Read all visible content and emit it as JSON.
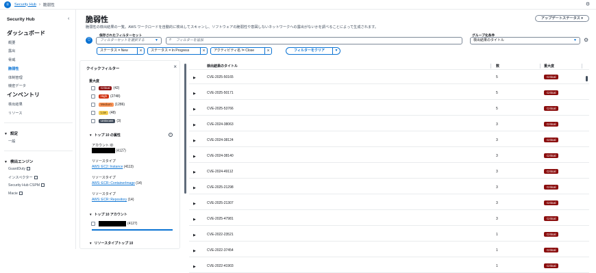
{
  "topbar": {
    "app_link": "Security Hub",
    "separator": "›",
    "current": "脆弱性"
  },
  "sidebar": {
    "title": "Security Hub",
    "sections": [
      {
        "heading": "ダッシュボード",
        "items": [
          "概要",
          "露出",
          "脅威",
          "脆弱性",
          "体制管理",
          "機密データ"
        ],
        "active": "脆弱性"
      },
      {
        "heading": "インベントリ",
        "items": [
          "検出結果",
          "リソース"
        ]
      }
    ],
    "settings": {
      "heading": "設定",
      "items": [
        "一般"
      ]
    },
    "engines": {
      "heading": "検出エンジン",
      "items": [
        "GuardDuty",
        "インスペクター",
        "Security Hub CSPM",
        "Macie"
      ]
    }
  },
  "page": {
    "title": "脆弱性",
    "description": "脆弱性の検出結果の一覧。AWS ワークロードを自動的に検出してスキャンし、ソフトウェアの脆弱性や意図しないネットワークへの露出がないかを調べることによって生成されます。",
    "update_status": "アップデートステータス",
    "saved_filter_label": "保存されたフィルターセット",
    "saved_filter_placeholder": "フィルターセットを選択する",
    "search_placeholder": "フィルターを追加",
    "group_label": "グループ化条件",
    "group_value": "検出結果のタイトル",
    "tokens": [
      "ステータス = New",
      "ステータス = In Progress",
      "アクティビティ名 != Close"
    ],
    "clear_label": "フィルターをクリア"
  },
  "quick_filter": {
    "title": "クイックフィルター",
    "severity_heading": "重大度",
    "severities": [
      {
        "label": "Critical",
        "count": "(42)",
        "color": "#8b0e0e"
      },
      {
        "label": "High",
        "count": "(2748)",
        "color": "#d13212"
      },
      {
        "label": "Medium",
        "count": "(1286)",
        "color": "#f89256"
      },
      {
        "label": "Low",
        "count": "(48)",
        "color": "#f2cd54"
      },
      {
        "label": "Unknown",
        "count": "(3)",
        "color": "#414d5c"
      }
    ],
    "top10_attr_heading": "トップ 10 の属性",
    "account_id_label": "アカウント ID",
    "account_id_count": "(4127)",
    "resource_types": [
      {
        "label": "リソースタイプ",
        "value": "AWS::EC2::Instance",
        "count": "(4113)"
      },
      {
        "label": "リソースタイプ",
        "value": "AWS::ECR::ContainerImage",
        "count": "(14)"
      },
      {
        "label": "リソースタイプ",
        "value": "AWS::ECR::Repository",
        "count": "(14)"
      }
    ],
    "top10_accounts_heading": "トップ 10 アカウント",
    "top10_account_count": "(4127)",
    "top10_resource_heading": "リソースタイプトップ 10"
  },
  "table": {
    "headers": {
      "title": "検出結果のタイトル",
      "count": "数",
      "severity": "重大度"
    },
    "rows": [
      {
        "title": "CVE-2025-50165",
        "count": "5",
        "severity": "Critical"
      },
      {
        "title": "CVE-2025-50171",
        "count": "5",
        "severity": "Critical"
      },
      {
        "title": "CVE-2025-53766",
        "count": "5",
        "severity": "Critical"
      },
      {
        "title": "CVE-2024-38063",
        "count": "3",
        "severity": "Critical"
      },
      {
        "title": "CVE-2024-38124",
        "count": "3",
        "severity": "Critical"
      },
      {
        "title": "CVE-2024-38140",
        "count": "3",
        "severity": "Critical"
      },
      {
        "title": "CVE-2024-49112",
        "count": "3",
        "severity": "Critical"
      },
      {
        "title": "CVE-2025-21298",
        "count": "3",
        "severity": "Critical"
      },
      {
        "title": "CVE-2025-21307",
        "count": "3",
        "severity": "Critical"
      },
      {
        "title": "CVE-2025-47981",
        "count": "3",
        "severity": "Critical"
      },
      {
        "title": "CVE-2022-23521",
        "count": "1",
        "severity": "Critical"
      },
      {
        "title": "CVE-2022-37454",
        "count": "1",
        "severity": "Critical"
      },
      {
        "title": "CVE-2022-41903",
        "count": "1",
        "severity": "Critical"
      }
    ]
  }
}
